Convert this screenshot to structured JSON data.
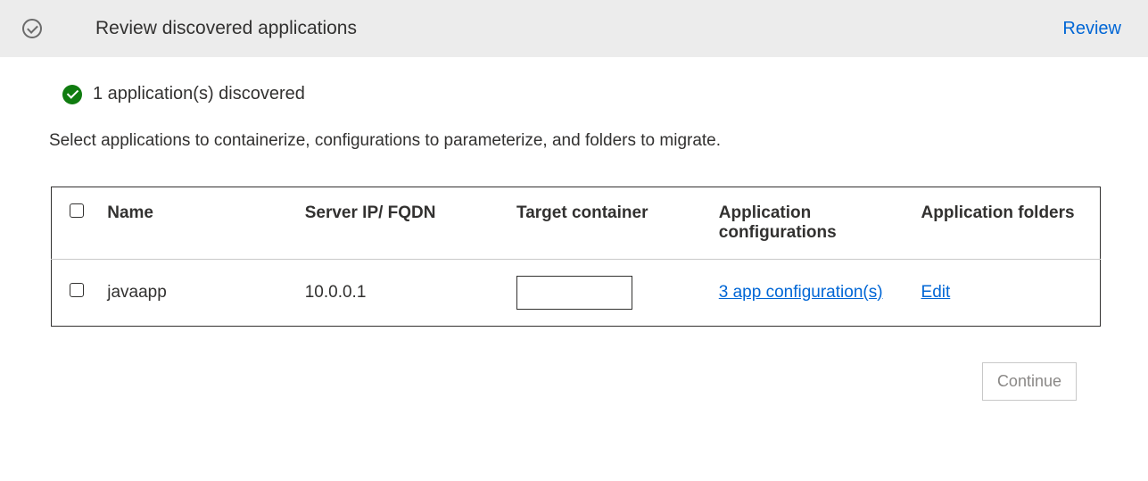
{
  "header": {
    "title": "Review discovered applications",
    "review_link": "Review"
  },
  "status": {
    "discovered_text": "1 application(s) discovered"
  },
  "instruction": "Select applications to containerize, configurations to parameterize, and folders to migrate.",
  "table": {
    "columns": {
      "name": "Name",
      "server": "Server IP/ FQDN",
      "target": "Target container",
      "config": "Application configurations",
      "folders": "Application folders"
    },
    "rows": [
      {
        "name": "javaapp",
        "server": "10.0.0.1",
        "target": "",
        "config": "3 app configuration(s)",
        "folders": "Edit"
      }
    ]
  },
  "footer": {
    "continue": "Continue"
  }
}
